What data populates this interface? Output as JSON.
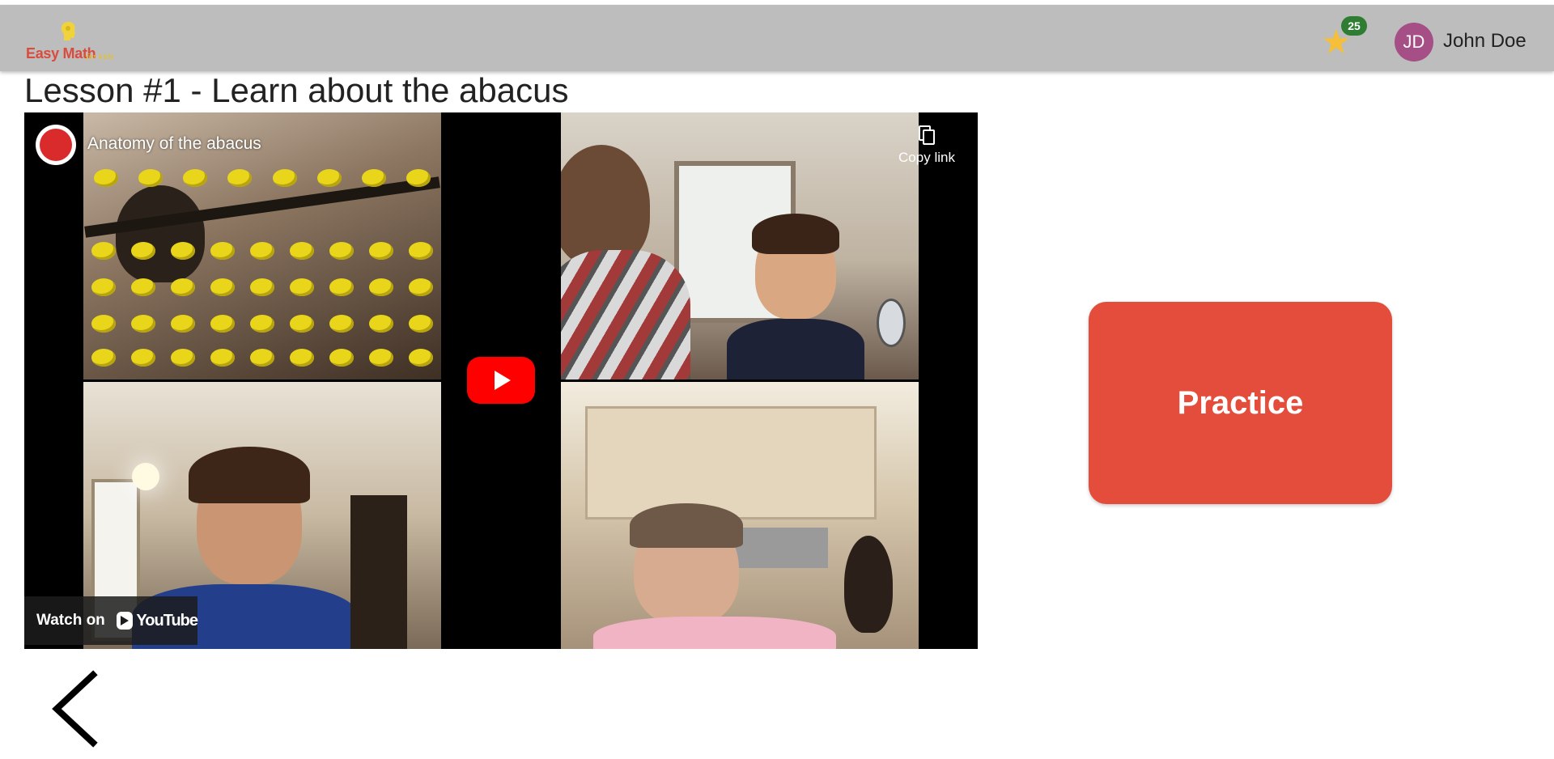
{
  "app": {
    "logo_text": "Easy Math",
    "logo_subtext": "for kids",
    "star_count": "25",
    "avatar_initials": "JD",
    "user_name": "John Doe"
  },
  "lesson": {
    "title": "Lesson #1 - Learn about the abacus"
  },
  "video": {
    "title": "Anatomy of the abacus",
    "copy_link_label": "Copy link",
    "watch_on_label": "Watch on",
    "youtube_label": "YouTube"
  },
  "actions": {
    "practice_label": "Practice"
  },
  "colors": {
    "appbar": "#bdbdbd",
    "practice": "#e44d3b",
    "badge": "#2e7d32",
    "avatar": "#a54f86",
    "star": "#f6bf3a"
  }
}
